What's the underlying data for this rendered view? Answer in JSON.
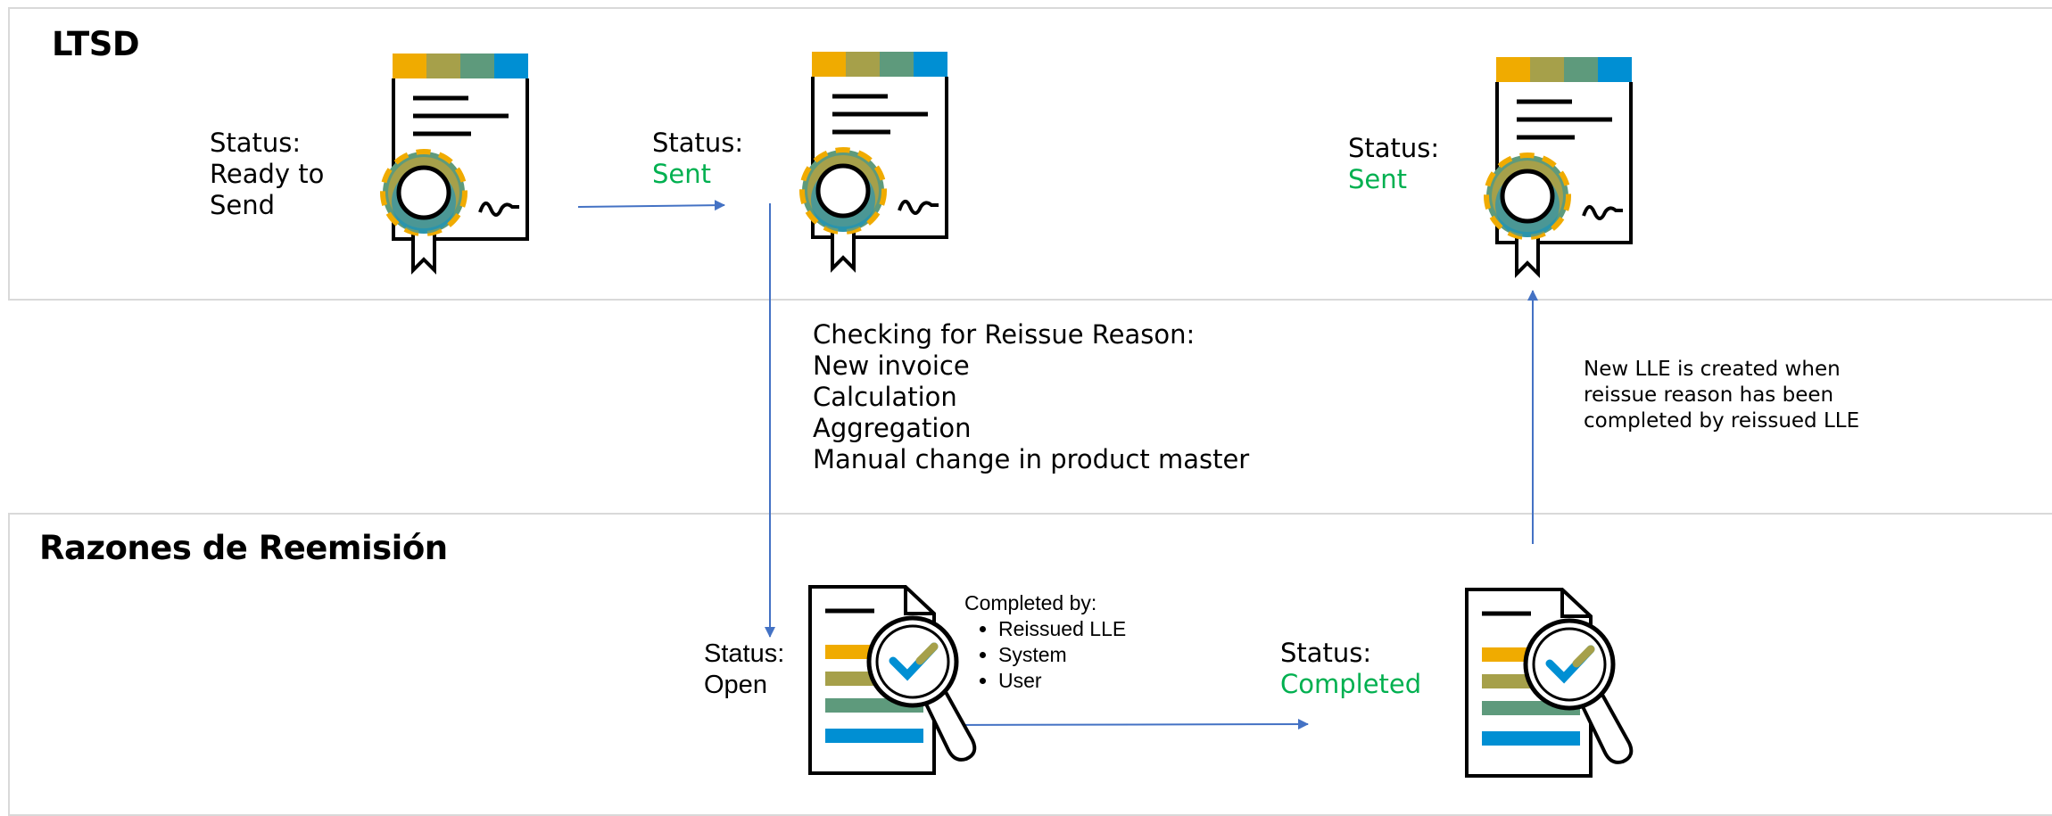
{
  "lanes": {
    "top_title": "LTSD",
    "bottom_title": "Razones de Reemisión"
  },
  "ltsd": {
    "status1_label": "Status:",
    "status1_value_line1": "Ready to",
    "status1_value_line2": "Send",
    "status2_label": "Status:",
    "status2_value": "Sent",
    "status3_label": "Status:",
    "status3_value": "Sent"
  },
  "checking": {
    "heading": "Checking for Reissue Reason:",
    "items": [
      "New invoice",
      "Calculation",
      "Aggregation",
      "Manual change in product master"
    ]
  },
  "new_lle_note": {
    "line1": "New LLE is created when",
    "line2": "reissue reason has been",
    "line3": "completed by reissued LLE"
  },
  "reasons": {
    "open_label": "Status:",
    "open_value": "Open",
    "completed_by_heading": "Completed by:",
    "completed_by_items": [
      "Reissued LLE",
      "System",
      "User"
    ],
    "completed_label": "Status:",
    "completed_value": "Completed"
  },
  "colors": {
    "yellow": "#f0ab00",
    "olive": "#a6a04a",
    "teal": "#5e9a7c",
    "blue": "#008fd3",
    "arrow": "#4472c4",
    "status_green": "#00b050",
    "lane_border": "#d9d9d9"
  },
  "icons": [
    "certificate-icon",
    "document-magnifier-icon"
  ]
}
